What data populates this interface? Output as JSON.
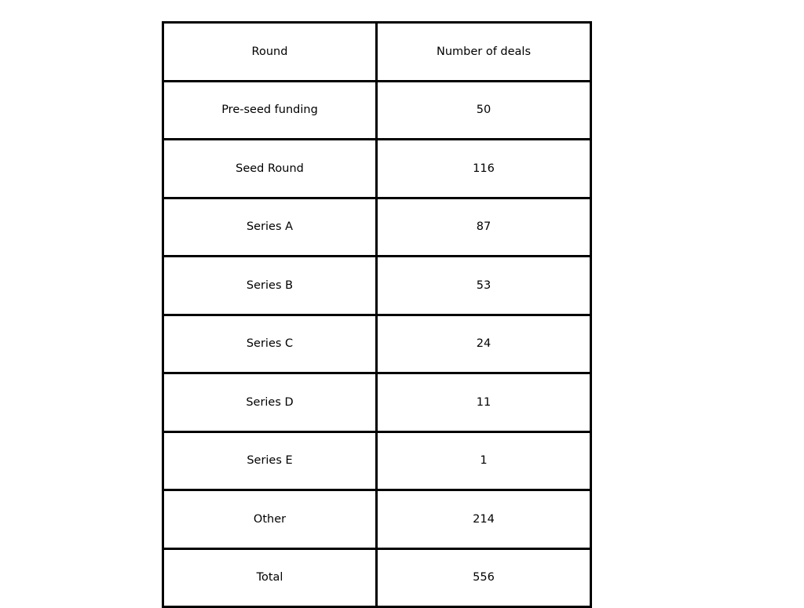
{
  "chart_data": {
    "type": "table",
    "title": "",
    "columns": [
      "Round",
      "Number of deals"
    ],
    "rows": [
      {
        "round": "Pre-seed funding",
        "deals": "50"
      },
      {
        "round": "Seed Round",
        "deals": "116"
      },
      {
        "round": "Series A",
        "deals": "87"
      },
      {
        "round": "Series B",
        "deals": "53"
      },
      {
        "round": "Series C",
        "deals": "24"
      },
      {
        "round": "Series D",
        "deals": "11"
      },
      {
        "round": "Series E",
        "deals": "1"
      },
      {
        "round": "Other",
        "deals": "214"
      },
      {
        "round": "Total",
        "deals": "556"
      }
    ]
  }
}
